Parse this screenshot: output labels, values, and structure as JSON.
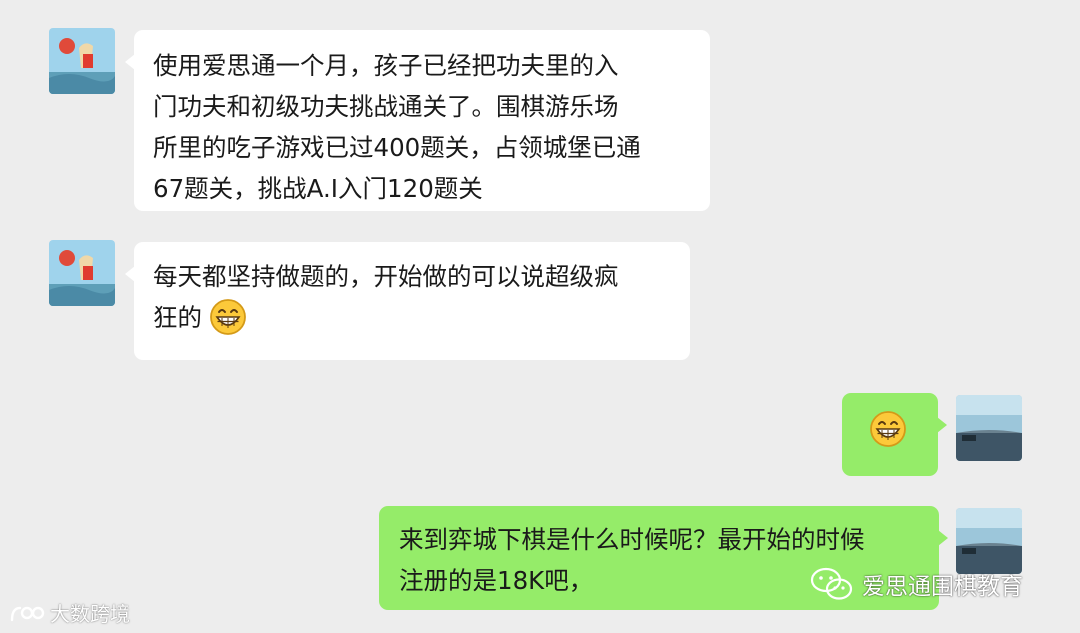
{
  "messages": [
    {
      "side": "left",
      "lines": [
        "使用爱思通一个月，孩子已经把功夫里的入",
        "门功夫和初级功夫挑战通关了。围棋游乐场",
        "所里的吃子游戏已过400题关，占领城堡已通",
        "67题关，挑战A.I入门120题关"
      ]
    },
    {
      "side": "left",
      "lines": [
        "每天都坚持做题的，开始做的可以说超级疯",
        "狂的"
      ],
      "emoji": "grinning-emoji"
    },
    {
      "side": "right",
      "emoji": "grinning-emoji"
    },
    {
      "side": "right",
      "lines": [
        "来到弈城下棋是什么时候呢？最开始的时候",
        "注册的是18K吧，"
      ]
    }
  ],
  "watermarks": {
    "left": "大数跨境",
    "right": "爱思通围棋教育"
  },
  "colors": {
    "background": "#ededed",
    "bubble_left": "#ffffff",
    "bubble_right": "#95ec69"
  }
}
